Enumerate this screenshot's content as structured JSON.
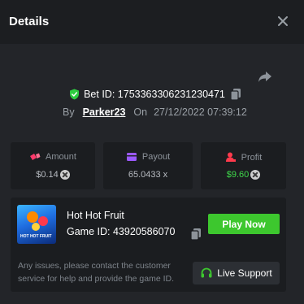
{
  "header": {
    "title": "Details"
  },
  "bet": {
    "id_label": "Bet ID:",
    "id_value": "1753363306231230471",
    "by_label": "By",
    "username": "Parker23",
    "on_label": "On",
    "timestamp": "27/12/2022 07:39:12"
  },
  "stats": {
    "amount": {
      "label": "Amount",
      "value": "$0.14",
      "icon": "dice-icon",
      "icon_color": "#ff3a6b"
    },
    "payout": {
      "label": "Payout",
      "value": "65.0433 x",
      "icon": "wallet-icon",
      "icon_color": "#9b59ff"
    },
    "profit": {
      "label": "Profit",
      "value": "$9.60",
      "icon": "profit-icon",
      "icon_color": "#ff3a4c"
    }
  },
  "game": {
    "name": "Hot Hot Fruit",
    "id_text": "Game ID: 43920586070",
    "thumb_text": "HOT HOT FRUIT",
    "play_label": "Play Now",
    "notice": "Any issues, please contact the customer service for help and provide the game ID.",
    "support_label": "Live Support"
  },
  "colors": {
    "accent_green": "#3dc72e",
    "profit_green": "#3fd94a",
    "shield_green": "#2ecc40"
  }
}
